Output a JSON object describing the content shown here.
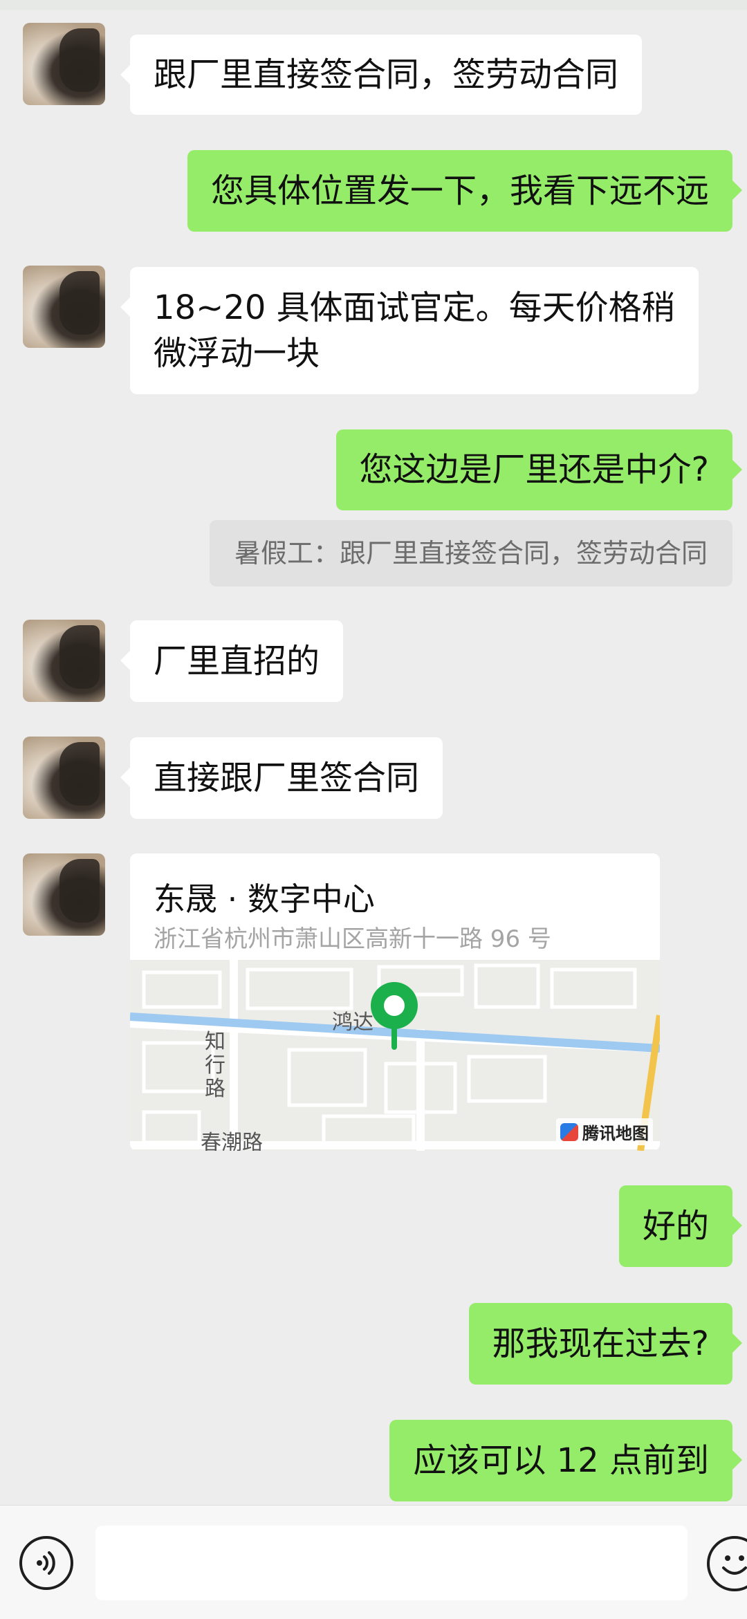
{
  "messages": [
    {
      "dir": "in",
      "text": "跟厂里直接签合同，签劳动合同"
    },
    {
      "dir": "out",
      "text": "您具体位置发一下，我看下远不远"
    },
    {
      "dir": "in",
      "line1": "18~20 具体面试官定。每天价格稍",
      "line2": "微浮动一块"
    },
    {
      "dir": "out",
      "text": "您这边是厂里还是中介?",
      "quote": "暑假工：跟厂里直接签合同，签劳动合同"
    },
    {
      "dir": "in",
      "text": "厂里直招的"
    },
    {
      "dir": "in",
      "text": "直接跟厂里签合同"
    },
    {
      "dir": "out",
      "text": "好的"
    },
    {
      "dir": "out",
      "text": "那我现在过去?"
    },
    {
      "dir": "out",
      "text": "应该可以 12 点前到"
    }
  ],
  "location": {
    "title": "东晟 · 数字中心",
    "address": "浙江省杭州市萧山区高新十一路 96 号",
    "map_labels": {
      "road_1": "鸿达",
      "road_2_chars": [
        "知",
        "行",
        "路"
      ],
      "road_3": "春潮路"
    },
    "credit": "腾讯地图"
  },
  "colors": {
    "outgoing_bubble": "#95ec69",
    "incoming_bubble": "#ffffff",
    "background": "#ededed",
    "map_pin": "#1bb04b",
    "map_river": "#9ec9f0"
  },
  "input_bar": {
    "voice_icon": "voice-icon",
    "emoji_icon": "emoji-icon",
    "input_value": ""
  }
}
